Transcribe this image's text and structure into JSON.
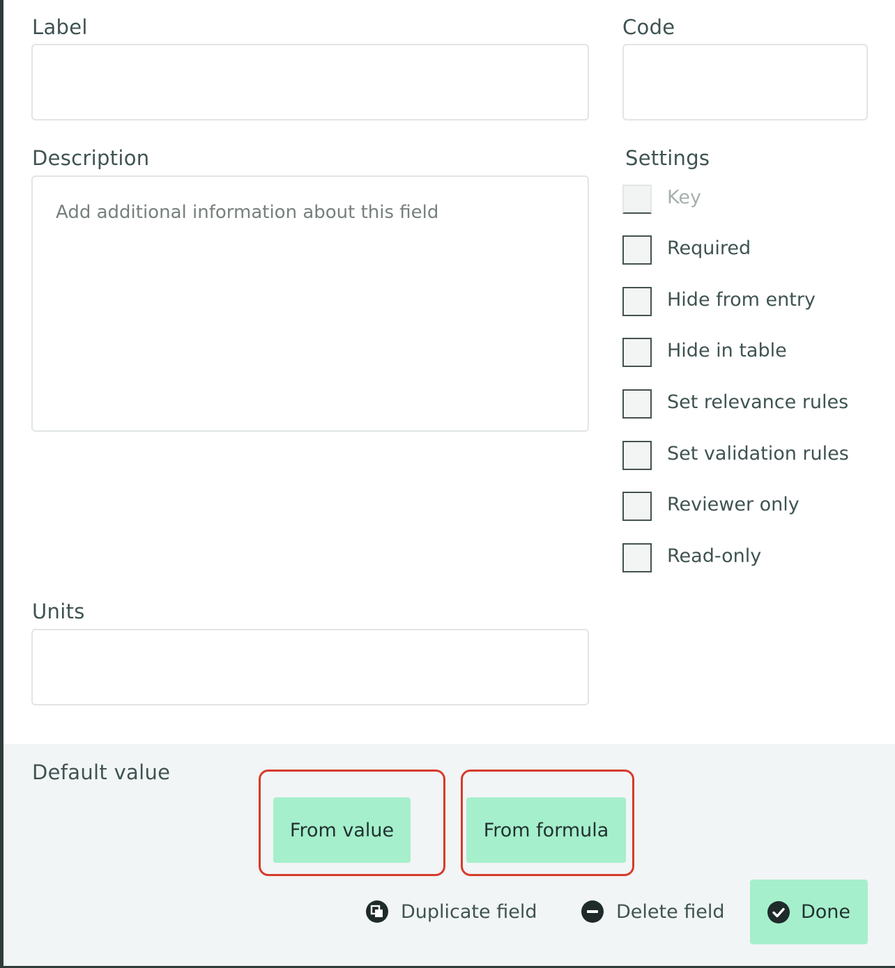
{
  "form": {
    "label": {
      "title": "Label",
      "value": ""
    },
    "code": {
      "title": "Code",
      "value": ""
    },
    "description": {
      "title": "Description",
      "placeholder": "Add additional information about this field",
      "value": ""
    },
    "units": {
      "title": "Units",
      "value": ""
    }
  },
  "settings": {
    "title": "Settings",
    "items": [
      {
        "label": "Key",
        "checked": false,
        "disabled": true
      },
      {
        "label": "Required",
        "checked": false,
        "disabled": false
      },
      {
        "label": "Hide from entry",
        "checked": false,
        "disabled": false
      },
      {
        "label": "Hide in table",
        "checked": false,
        "disabled": false
      },
      {
        "label": "Set relevance rules",
        "checked": false,
        "disabled": false
      },
      {
        "label": "Set validation rules",
        "checked": false,
        "disabled": false
      },
      {
        "label": "Reviewer only",
        "checked": false,
        "disabled": false
      },
      {
        "label": "Read-only",
        "checked": false,
        "disabled": false
      }
    ]
  },
  "default_value": {
    "title": "Default value",
    "from_value_label": "From value",
    "from_formula_label": "From formula"
  },
  "actions": {
    "duplicate_label": "Duplicate field",
    "delete_label": "Delete field",
    "done_label": "Done"
  },
  "colors": {
    "button_green": "#a5efcc",
    "highlight_red": "#d63b2b",
    "text": "#3f5352"
  }
}
